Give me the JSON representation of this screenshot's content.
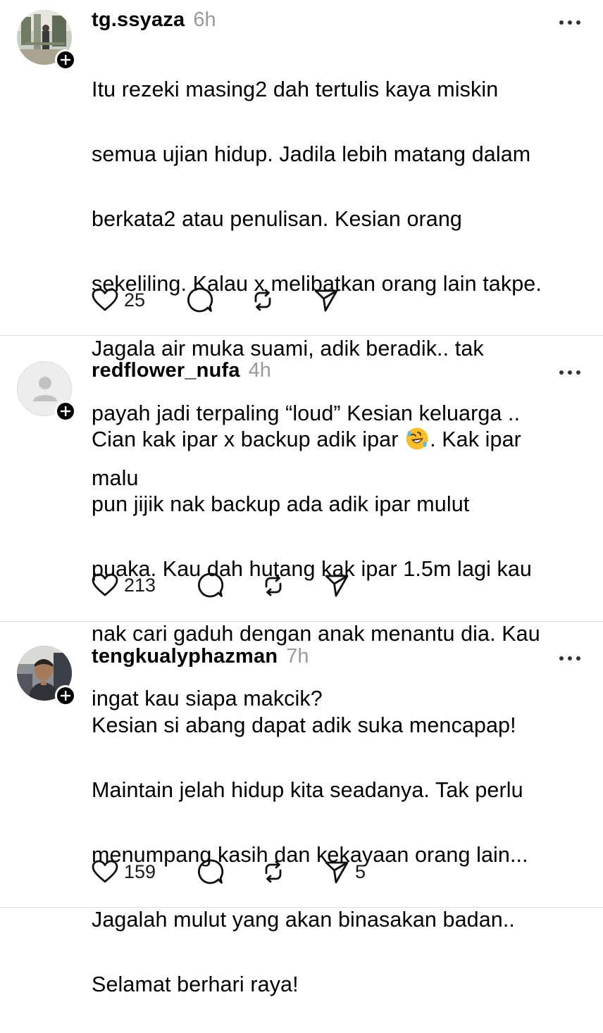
{
  "posts": [
    {
      "username": "tg.ssyaza",
      "time": "6h",
      "avatar": "profile-photo",
      "text_lines": [
        "Itu rezeki masing2 dah tertulis kaya miskin",
        "semua ujian hidup. Jadila lebih matang dalam",
        "berkata2 atau penulisan. Kesian orang",
        "sekeliling. Kalau x melibatkan orang lain takpe.",
        "Jagala air muka suami, adik beradik.. tak",
        "payah jadi terpaling “loud” Kesian keluarga ..",
        "malu"
      ],
      "likes": "25",
      "shares": ""
    },
    {
      "username": "redflower_nufa",
      "time": "4h",
      "avatar": "default-avatar",
      "text_lines_before_emoji": "Cian kak ipar x backup adik ipar ",
      "emoji": "rolling-on-floor-laughing",
      "text_lines_after_emoji": ". Kak ipar",
      "text_lines": [
        "pun jijik nak backup ada adik ipar mulut",
        "puaka. Kau dah hutang kak ipar 1.5m lagi kau",
        "nak cari gaduh dengan anak menantu dia. Kau",
        "ingat kau siapa makcik?"
      ],
      "likes": "213",
      "shares": ""
    },
    {
      "username": "tengkualyphazman",
      "time": "7h",
      "avatar": "profile-photo",
      "text_lines": [
        "Kesian si abang dapat adik suka mencapap!",
        "Maintain jelah hidup kita seadanya. Tak perlu",
        "menumpang kasih dan kekayaan orang lain...",
        "Jagalah mulut yang akan binasakan badan..",
        "Selamat berhari raya!"
      ],
      "likes": "159",
      "shares": "5"
    }
  ],
  "icons": {
    "like": "heart-icon",
    "reply": "comment-icon",
    "repost": "repost-icon",
    "share": "send-icon",
    "more": "more-icon",
    "follow": "plus-icon"
  },
  "colors": {
    "text": "#000000",
    "meta": "#9a9a9a",
    "divider": "#dedede",
    "badge": "#000000"
  }
}
